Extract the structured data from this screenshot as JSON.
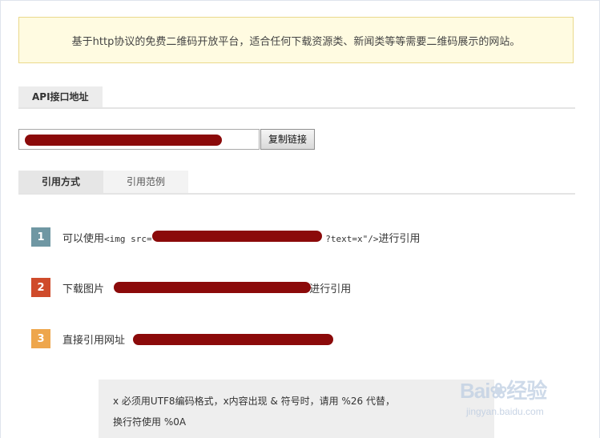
{
  "notice": {
    "text": "基于http协议的免费二维码开放平台，适合任何下载资源类、新闻类等等需要二维码展示的网站。"
  },
  "api_section": {
    "title": "API接口地址",
    "url_value": "",
    "copy_button": "复制链接"
  },
  "tabs": [
    {
      "label": "引用方式",
      "active": true
    },
    {
      "label": "引用范例",
      "active": false
    }
  ],
  "steps": [
    {
      "num": "1",
      "color": "#6f97a3",
      "prefix": "可以使用",
      "code_start": "<img src=\"",
      "code_end": "?text=x\"/>",
      "suffix": "进行引用"
    },
    {
      "num": "2",
      "color": "#cf4b2b",
      "prefix": "下载图片 ",
      "suffix": " 进行引用"
    },
    {
      "num": "3",
      "color": "#eea64c",
      "prefix": "直接引用网址 ",
      "suffix": ""
    }
  ],
  "note": {
    "line1": "x 必须用UTF8编码格式，x内容出现 & 符号时，请用 %26 代替，",
    "line2": "换行符使用 %0A"
  },
  "watermark": {
    "logo": "Bai❀经验",
    "sub": "jingyan.baidu.com"
  }
}
